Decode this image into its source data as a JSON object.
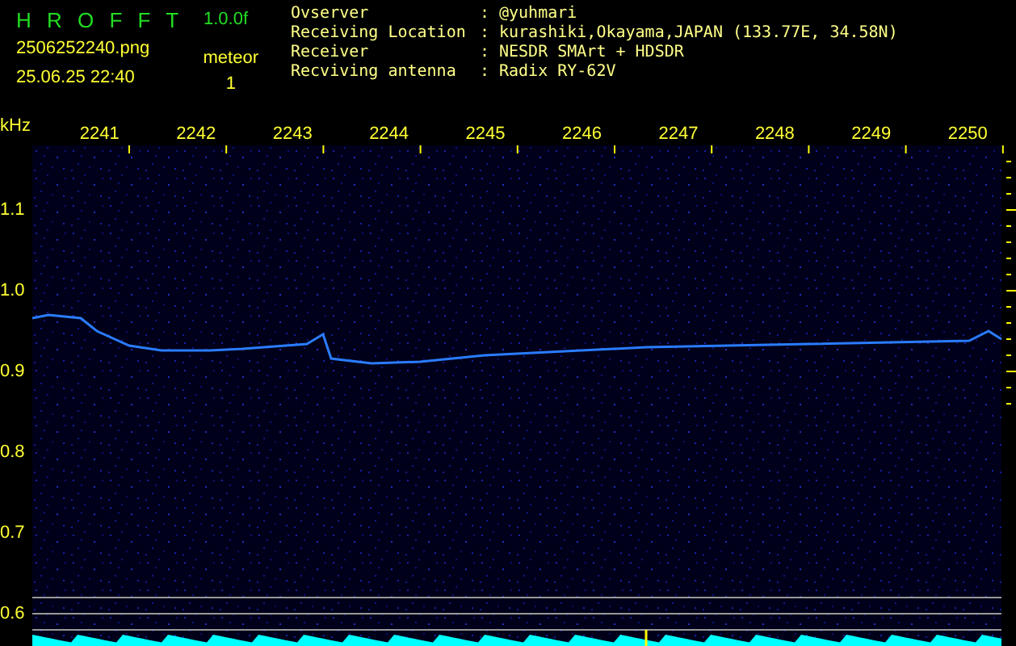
{
  "header": {
    "title": "H R O F F T",
    "version": "1.0.0f",
    "filename": "2506252240.png",
    "datetime": "25.06.25 22:40",
    "count_label": "meteor",
    "count": "1"
  },
  "info": [
    {
      "label": "Ovserver",
      "separator": ":",
      "value": "@yuhmari"
    },
    {
      "label": "Receiving Location",
      "separator": ":",
      "value": "kurashiki,Okayama,JAPAN (133.77E, 34.58N)"
    },
    {
      "label": "Receiver",
      "separator": ":",
      "value": "NESDR SMArt + HDSDR"
    },
    {
      "label": "Recviving antenna",
      "separator": ":",
      "value": "Radix RY-62V"
    }
  ],
  "plot": {
    "unit": "kHz",
    "x_labels": [
      "2241",
      "2242",
      "2243",
      "2244",
      "2245",
      "2246",
      "2247",
      "2248",
      "2249",
      "2250"
    ],
    "y_labels": [
      "1.1",
      "1.0",
      "0.9",
      "0.8",
      "0.7",
      "0.6"
    ]
  }
}
